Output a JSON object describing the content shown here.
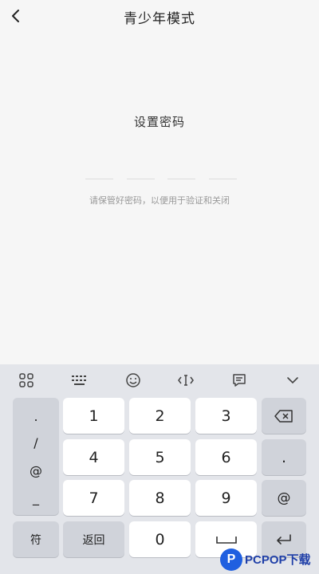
{
  "header": {
    "title": "青少年模式"
  },
  "main": {
    "set_password_label": "设置密码",
    "hint": "请保管好密码，以便用于验证和关闭"
  },
  "keyboard": {
    "symbols": [
      ".",
      "/",
      "@",
      "_"
    ],
    "digit_keys": [
      "1",
      "2",
      "3",
      "4",
      "5",
      "6",
      "7",
      "8",
      "9"
    ],
    "right_keys": {
      "dot": ".",
      "at": "@"
    },
    "bottom": {
      "symbol_key": "符",
      "return_key": "返回",
      "zero_key": "0"
    },
    "toolbar_icons": [
      "grid-icon",
      "keyboard-layout-icon",
      "emoji-icon",
      "cursor-icon",
      "clipboard-icon",
      "collapse-icon"
    ]
  },
  "watermark": {
    "text": "PCPOP下载",
    "logo_letter": "P"
  },
  "colors": {
    "background": "#f6f6f6",
    "keyboard": "#e3e5ea",
    "key": "#ffffff",
    "function_key": "#d0d3da"
  }
}
